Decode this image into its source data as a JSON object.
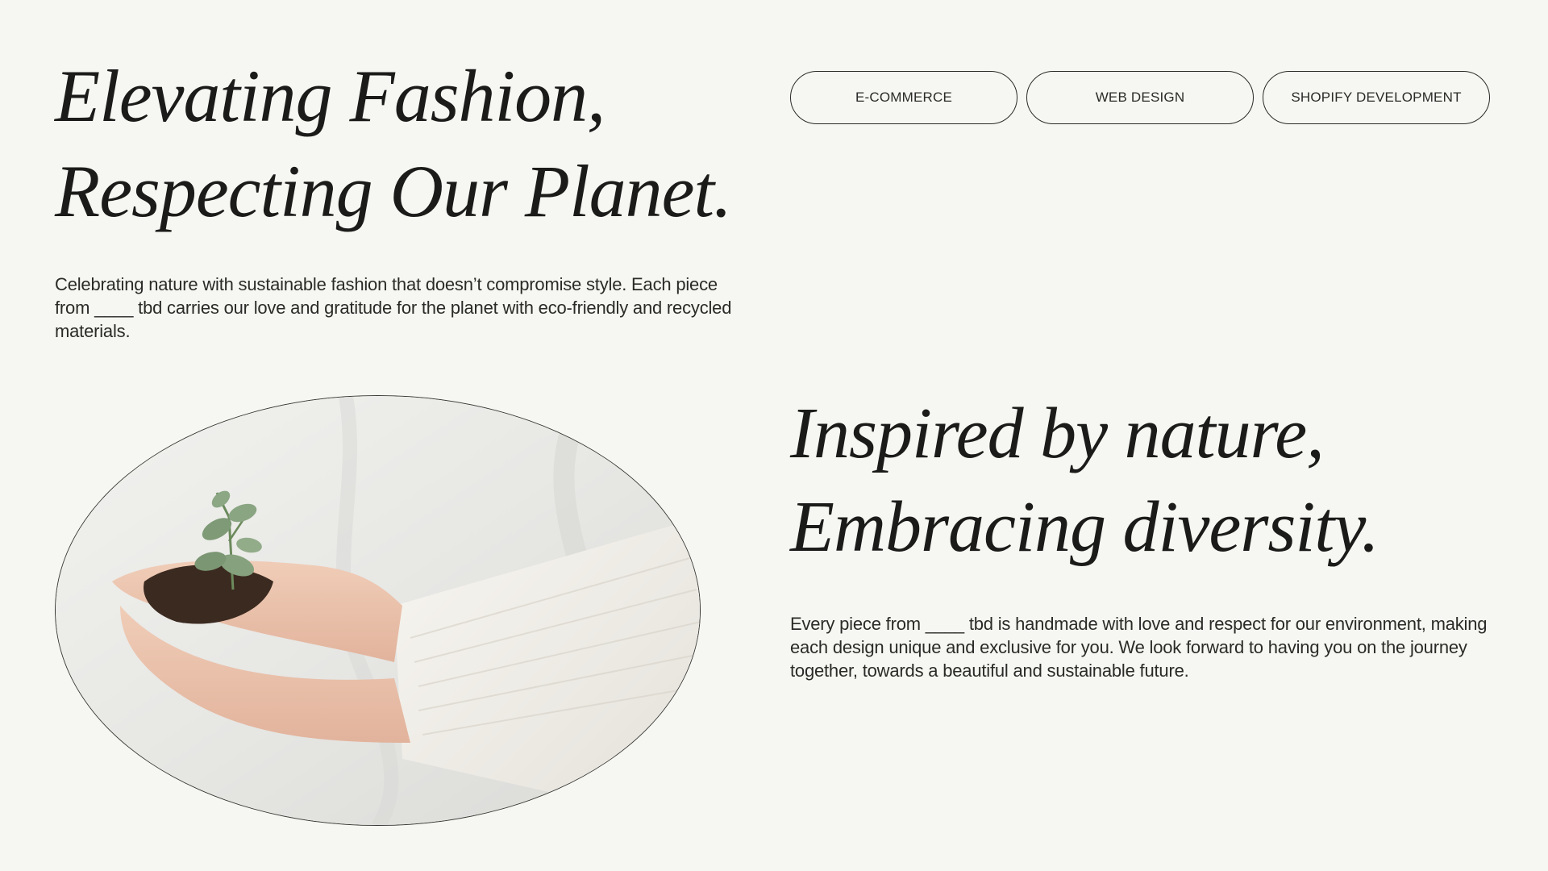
{
  "hero": {
    "title_line1": "Elevating Fashion,",
    "title_line2": "Respecting Our Planet.",
    "description": "Celebrating nature with sustainable fashion that doesn’t compromise style. Each piece from ____ tbd carries our love and gratitude for the planet with eco-friendly and recycled materials."
  },
  "tags": [
    {
      "label": "E-COMMERCE"
    },
    {
      "label": "WEB DESIGN"
    },
    {
      "label": "SHOPIFY DEVELOPMENT"
    }
  ],
  "image": {
    "icon": "hands-holding-seedling-photo"
  },
  "section": {
    "title_line1": "Inspired by nature,",
    "title_line2": "Embracing diversity.",
    "description": "Every piece from ____ tbd is handmade with love and respect for our environment, making each design unique and exclusive for you. We look forward to having you on the journey together, towards a beautiful and sustainable future."
  },
  "colors": {
    "background": "#f6f7f3",
    "text": "#1b1b19",
    "border": "#2a2a27"
  }
}
